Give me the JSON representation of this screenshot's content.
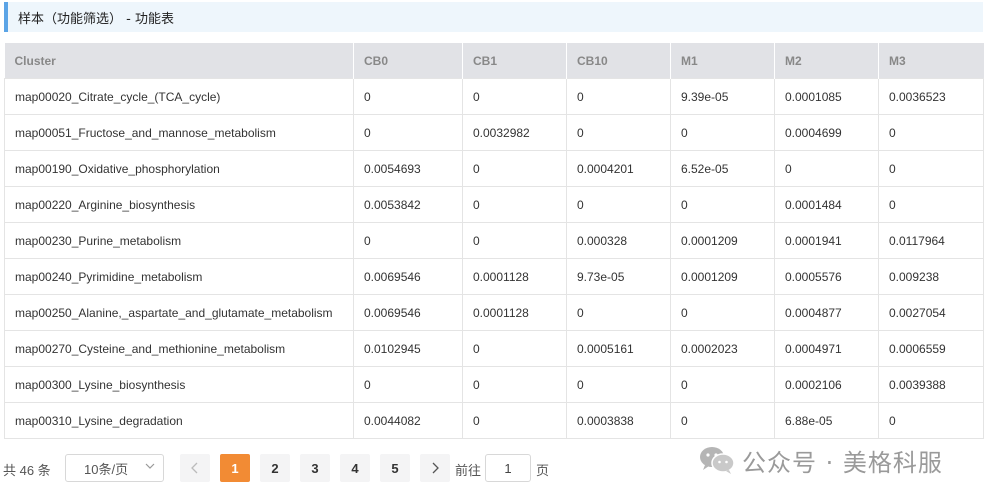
{
  "header": {
    "title": "样本（功能筛选） - 功能表"
  },
  "table": {
    "columns": [
      "Cluster",
      "CB0",
      "CB1",
      "CB10",
      "M1",
      "M2",
      "M3"
    ],
    "rows": [
      [
        "map00020_Citrate_cycle_(TCA_cycle)",
        "0",
        "0",
        "0",
        "9.39e-05",
        "0.0001085",
        "0.0036523"
      ],
      [
        "map00051_Fructose_and_mannose_metabolism",
        "0",
        "0.0032982",
        "0",
        "0",
        "0.0004699",
        "0"
      ],
      [
        "map00190_Oxidative_phosphorylation",
        "0.0054693",
        "0",
        "0.0004201",
        "6.52e-05",
        "0",
        "0"
      ],
      [
        "map00220_Arginine_biosynthesis",
        "0.0053842",
        "0",
        "0",
        "0",
        "0.0001484",
        "0"
      ],
      [
        "map00230_Purine_metabolism",
        "0",
        "0",
        "0.000328",
        "0.0001209",
        "0.0001941",
        "0.0117964"
      ],
      [
        "map00240_Pyrimidine_metabolism",
        "0.0069546",
        "0.0001128",
        "9.73e-05",
        "0.0001209",
        "0.0005576",
        "0.009238"
      ],
      [
        "map00250_Alanine,_aspartate_and_glutamate_metabolism",
        "0.0069546",
        "0.0001128",
        "0",
        "0",
        "0.0004877",
        "0.0027054"
      ],
      [
        "map00270_Cysteine_and_methionine_metabolism",
        "0.0102945",
        "0",
        "0.0005161",
        "0.0002023",
        "0.0004971",
        "0.0006559"
      ],
      [
        "map00300_Lysine_biosynthesis",
        "0",
        "0",
        "0",
        "0",
        "0.0002106",
        "0.0039388"
      ],
      [
        "map00310_Lysine_degradation",
        "0.0044082",
        "0",
        "0.0003838",
        "0",
        "6.88e-05",
        "0"
      ]
    ]
  },
  "pagination": {
    "total": "共 46 条",
    "page_size": "10条/页",
    "prev_icon": "chevron-left-icon",
    "next_icon": "chevron-right-icon",
    "pages": [
      "1",
      "2",
      "3",
      "4",
      "5"
    ],
    "current_page": "1",
    "goto_label": "前往",
    "goto_value": "1",
    "goto_unit": "页"
  },
  "watermark": {
    "text": "公众号 · 美格科服",
    "icon": "wechat-icon"
  },
  "colors": {
    "accent": "#f28b34",
    "title_border": "#5ba4e6",
    "header_bg": "#e1e2e6"
  }
}
